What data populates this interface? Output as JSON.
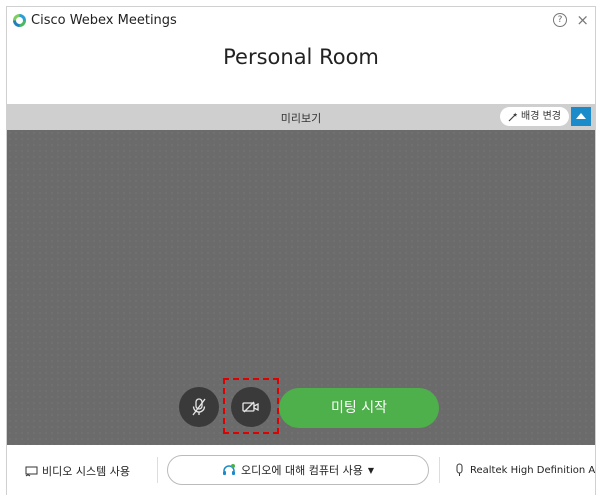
{
  "window": {
    "app_title": "Cisco Webex Meetings",
    "help_label": "?",
    "close_label": "×"
  },
  "room": {
    "title": "Personal Room"
  },
  "preview": {
    "label": "미리보기",
    "background_change_label": "배경 변경"
  },
  "controls": {
    "start_meeting_label": "미팅 시작"
  },
  "bottom": {
    "video_system_label": "비디오 시스템 사용",
    "audio_label": "오디오에 대해 컴퓨터 사용",
    "audio_caret": "▼",
    "microphone_device": "Realtek High Definition A..."
  },
  "colors": {
    "accent_green": "#4db04a",
    "accent_blue": "#1c8bc9",
    "highlight_red": "#e00000",
    "video_bg": "#6b6b6b"
  }
}
